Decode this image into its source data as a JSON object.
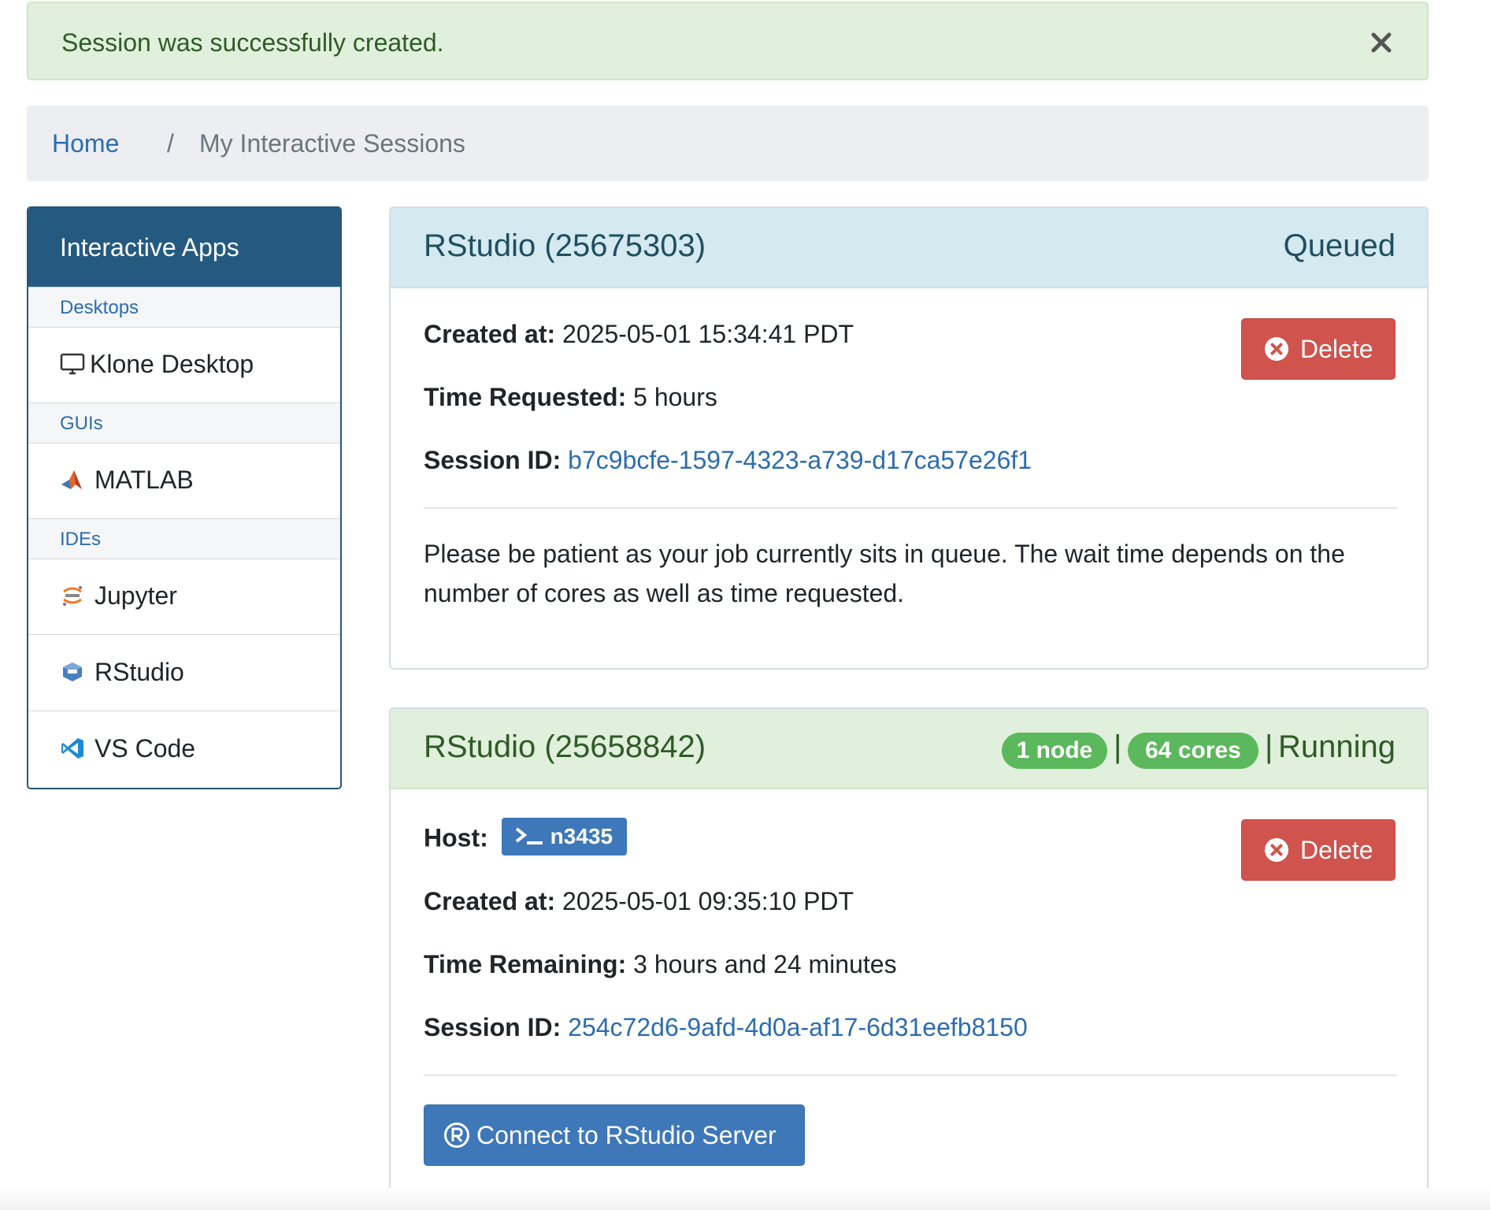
{
  "alert": {
    "message": "Session was successfully created."
  },
  "breadcrumb": {
    "home": "Home",
    "separator": "/",
    "current": "My Interactive Sessions"
  },
  "sidebar": {
    "header": "Interactive Apps",
    "categories": [
      {
        "label": "Desktops",
        "items": [
          {
            "label": "Klone Desktop",
            "icon": "monitor-icon"
          }
        ]
      },
      {
        "label": "GUIs",
        "items": [
          {
            "label": "MATLAB",
            "icon": "matlab-icon"
          }
        ]
      },
      {
        "label": "IDEs",
        "items": [
          {
            "label": "Jupyter",
            "icon": "jupyter-icon"
          },
          {
            "label": "RStudio",
            "icon": "rstudio-icon"
          },
          {
            "label": "VS Code",
            "icon": "vscode-icon"
          }
        ]
      }
    ]
  },
  "sessions": [
    {
      "title": "RStudio (25675303)",
      "status": "Queued",
      "created_label": "Created at:",
      "created_value": "2025-05-01 15:34:41 PDT",
      "time_label": "Time Requested:",
      "time_value": "5 hours",
      "session_label": "Session ID:",
      "session_id": "b7c9bcfe-1597-4323-a739-d17ca57e26f1",
      "delete_label": "Delete",
      "message": "Please be patient as your job currently sits in queue. The wait time depends on the number of cores as well as time requested."
    },
    {
      "title": "RStudio (25658842)",
      "nodes_badge": "1 node",
      "cores_badge": "64 cores",
      "separator": "|",
      "status": "Running",
      "host_label": "Host:",
      "host_value": "n3435",
      "created_label": "Created at:",
      "created_value": "2025-05-01 09:35:10 PDT",
      "time_label": "Time Remaining:",
      "time_value": "3 hours and 24 minutes",
      "session_label": "Session ID:",
      "session_id": "254c72d6-9afd-4d0a-af17-6d31eefb8150",
      "delete_label": "Delete",
      "connect_label": "Connect to RStudio Server"
    }
  ],
  "colors": {
    "primary": "#3e78b8",
    "danger": "#d0534d",
    "success_badge": "#5cb85c",
    "sidebar_header": "#245a80"
  }
}
